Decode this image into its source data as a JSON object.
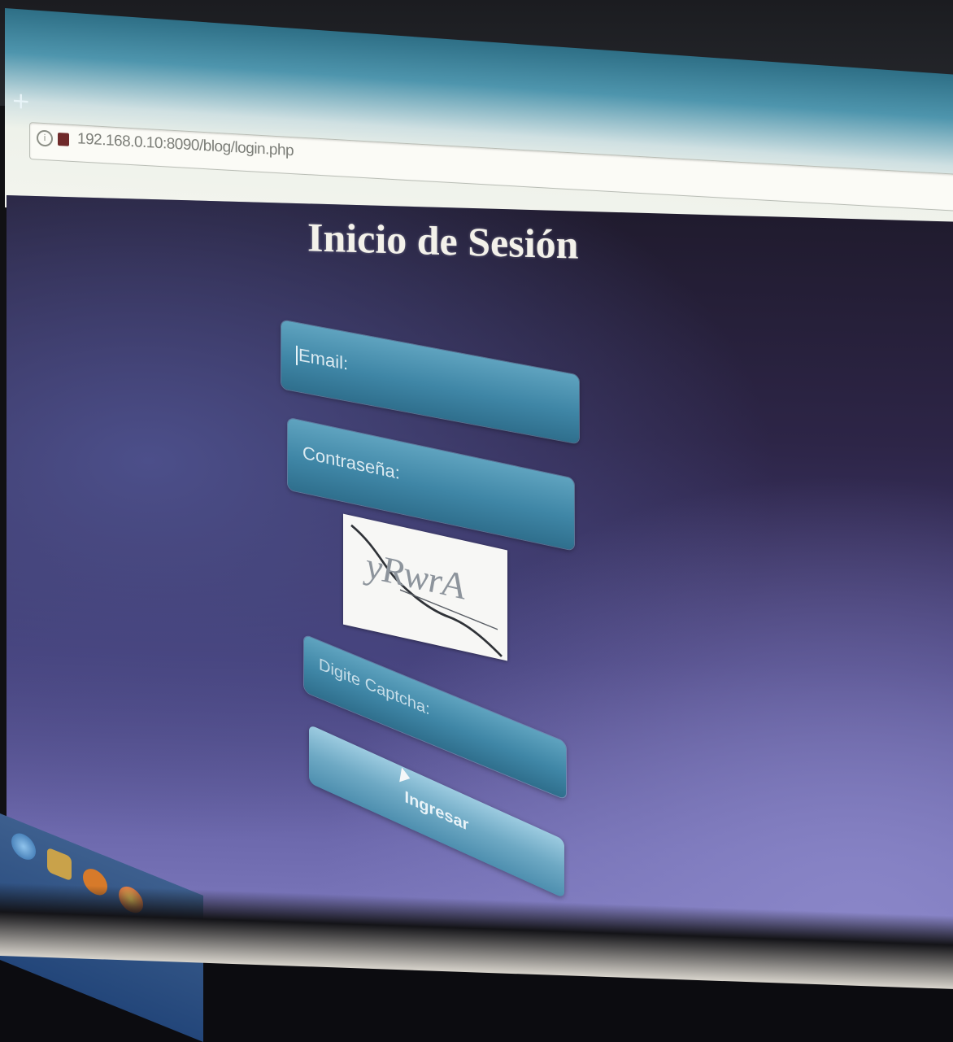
{
  "browser": {
    "new_tab_glyph": "+",
    "url": "192.168.0.10:8090/blog/login.php",
    "info_icon": "info-icon",
    "site_icon": "site-favicon"
  },
  "login": {
    "title": "Inicio de Sesión",
    "email_placeholder": "Email:",
    "password_placeholder": "Contraseña:",
    "captcha_image_text": "yRwrA",
    "captcha_placeholder": "Digite Captcha:",
    "submit_label": "Ingresar"
  },
  "colors": {
    "field_blue": "#3f86a6",
    "page_purple": "#433d77",
    "title_white": "#f3f1ea"
  }
}
